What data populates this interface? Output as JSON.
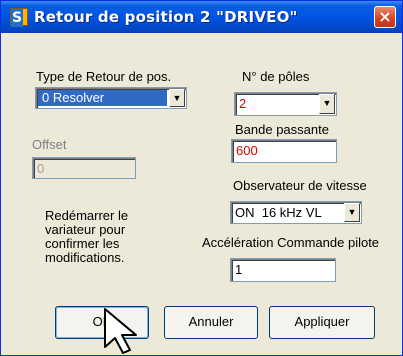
{
  "window": {
    "title": "Retour de position 2 \"DRIVEO\"",
    "icon_name": "app-s-icon",
    "close_label": "×"
  },
  "feedback": {
    "label": "Type de Retour de pos.",
    "selected": "0 Resolver"
  },
  "poles": {
    "label": "N° de pôles",
    "selected": "2"
  },
  "bandwidth": {
    "label": "Bande passante",
    "value": "600"
  },
  "offset": {
    "label": "Offset",
    "value": "0"
  },
  "observer": {
    "label": "Observateur de vitesse",
    "selected": "ON  16 kHz VL"
  },
  "restart_note": {
    "line1": "Redémarrer le",
    "line2": "variateur pour",
    "line3": "confirmer les",
    "line4": "modifications."
  },
  "acceleration": {
    "label": "Accélération Commande pilote",
    "value": "1"
  },
  "buttons": {
    "ok": "OK",
    "cancel": "Annuler",
    "apply": "Appliquer"
  },
  "colors": {
    "titlebar": "#0054e3",
    "dialog_bg": "#ece9d8",
    "value_red": "#e00000",
    "selection": "#316ac5"
  }
}
